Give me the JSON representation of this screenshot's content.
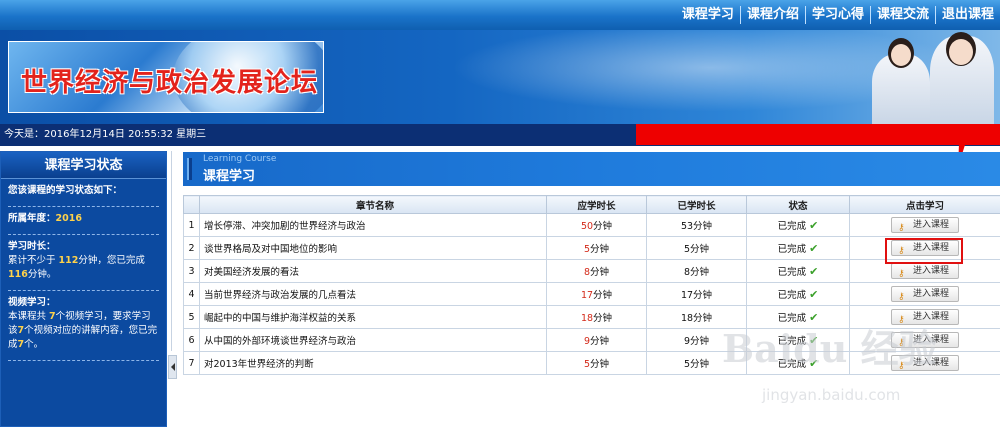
{
  "nav": {
    "items": [
      "课程学习",
      "课程介绍",
      "学习心得",
      "课程交流",
      "退出课程"
    ]
  },
  "banner": {
    "title": "世界经济与政治发展论坛"
  },
  "datebar": {
    "text": "今天是：2016年12月14日  20:55:32 星期三"
  },
  "sidebar": {
    "title": "课程学习状态",
    "intro": "您该课程的学习状态如下：",
    "year_label": "所属年度：",
    "year_value": "2016",
    "time_label": "学习时长：",
    "time_text_1": "累计不少于",
    "time_required": "112",
    "time_text_2": "分钟，您已完成",
    "time_done": "116",
    "time_text_3": "分钟。",
    "video_label": "视频学习：",
    "video_text_1": "本课程共",
    "video_total": "7",
    "video_text_2": "个视频学习，要求学习该",
    "video_req": "7",
    "video_text_3": "个视频对应的讲解内容，您已完成",
    "video_done": "7",
    "video_text_4": "个。"
  },
  "main": {
    "section_en": "Learning Course",
    "section_zh": "课程学习",
    "headers": [
      "章节名称",
      "应学时长",
      "已学时长",
      "状态",
      "点击学习"
    ],
    "unit": "分钟",
    "status_done": "已完成",
    "enter_label": "进入课程",
    "rows": [
      {
        "idx": "1",
        "name": "增长停滞、冲突加剧的世界经济与政治",
        "req": "50",
        "done": "53分钟"
      },
      {
        "idx": "2",
        "name": "谈世界格局及对中国地位的影响",
        "req": "5",
        "done": "5分钟"
      },
      {
        "idx": "3",
        "name": "对美国经济发展的看法",
        "req": "8",
        "done": "8分钟"
      },
      {
        "idx": "4",
        "name": "当前世界经济与政治发展的几点看法",
        "req": "17",
        "done": "17分钟"
      },
      {
        "idx": "5",
        "name": "崛起中的中国与维护海洋权益的关系",
        "req": "18",
        "done": "18分钟"
      },
      {
        "idx": "6",
        "name": "从中国的外部环境谈世界经济与政治",
        "req": "9",
        "done": "9分钟"
      },
      {
        "idx": "7",
        "name": "对2013年世界经济的判断",
        "req": "5",
        "done": "5分钟"
      }
    ]
  },
  "watermark": {
    "brand": "Baidu 经验",
    "url": "jingyan.baidu.com"
  },
  "icons": {
    "check": "check-icon",
    "enter": "key-icon",
    "collapse": "chevron-left-icon"
  },
  "colors": {
    "nav_bg": "#1a73c9",
    "date_bar": "#0c2f74",
    "sidebar_bg": "#0c4aa0",
    "highlight_red": "#ee0000",
    "status_green": "#3a9a1a",
    "number_red": "#d42a1a"
  }
}
